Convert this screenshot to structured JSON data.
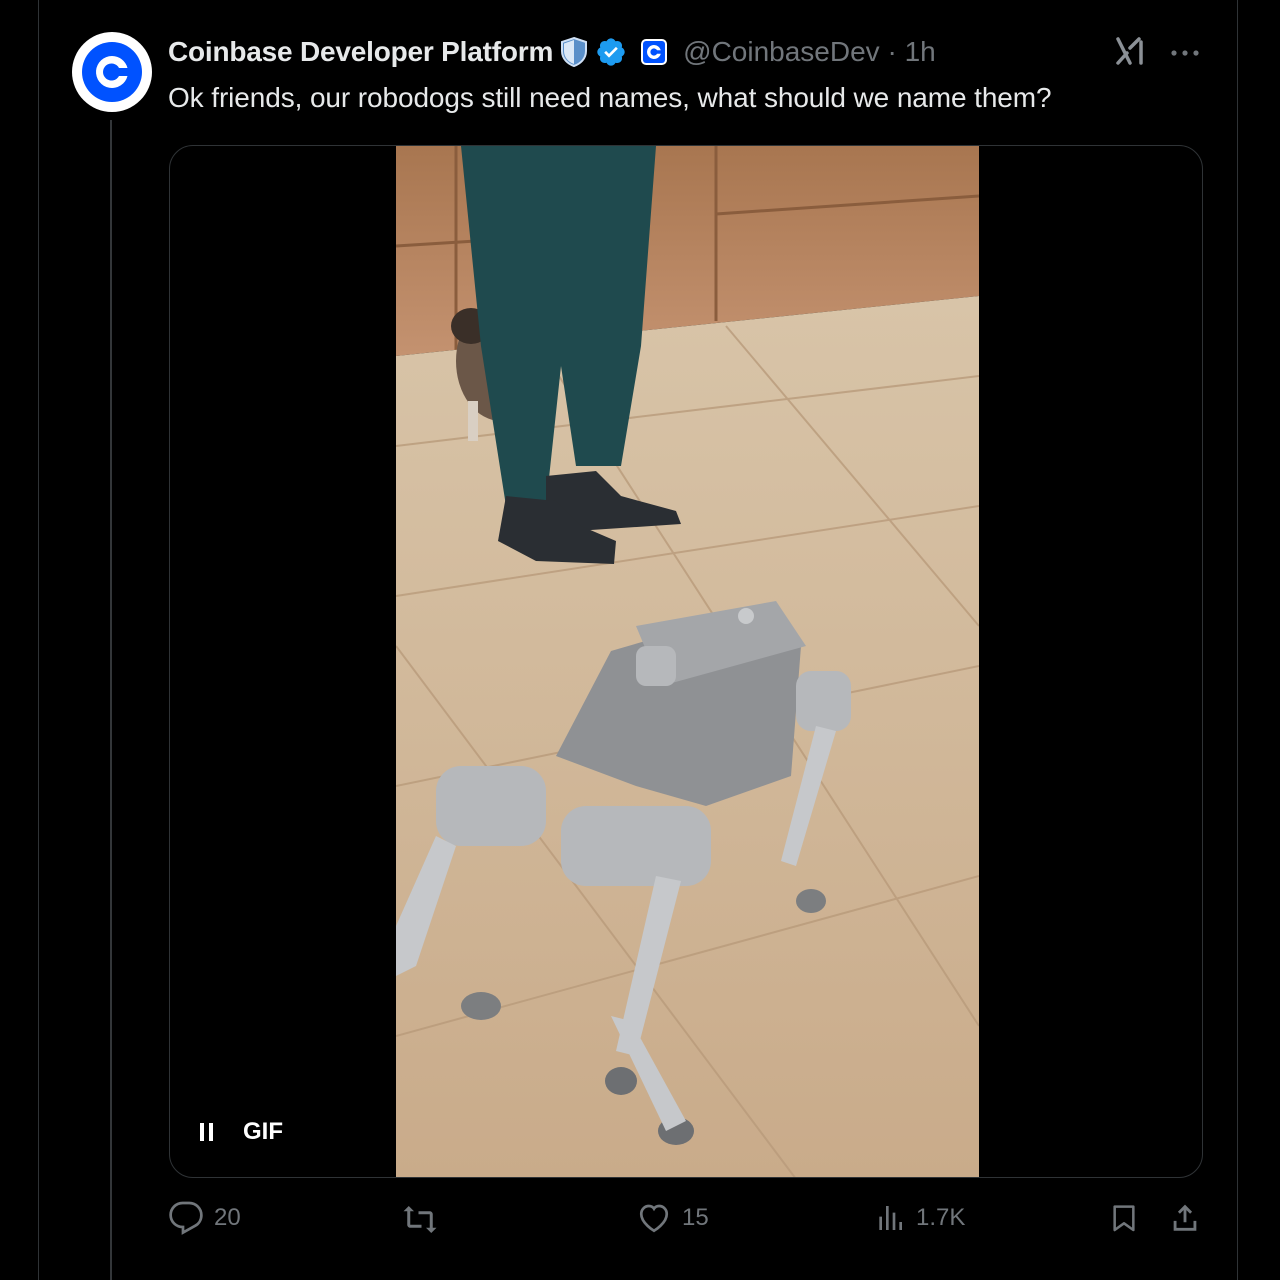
{
  "tweet": {
    "display_name": "Coinbase Developer Platform",
    "handle": "@CoinbaseDev",
    "separator": "·",
    "time": "1h",
    "text": "Ok friends, our robodogs still need names, what should we name them?"
  },
  "media": {
    "gif_label": "GIF",
    "controls": [
      "pause-icon"
    ]
  },
  "actions": {
    "replies": "20",
    "reposts": "",
    "likes": "15",
    "views": "1.7K"
  },
  "icons": [
    "coinbase-logo-icon",
    "shield-badge-icon",
    "verified-badge-icon",
    "affiliate-coinbase-icon",
    "grok-icon",
    "more-icon",
    "reply-icon",
    "repost-icon",
    "like-icon",
    "views-icon",
    "bookmark-icon",
    "share-icon"
  ],
  "colors": {
    "verified": "#1d9bf0",
    "coinbase_blue": "#0052ff",
    "muted": "#71767b",
    "text": "#e7e9ea"
  }
}
